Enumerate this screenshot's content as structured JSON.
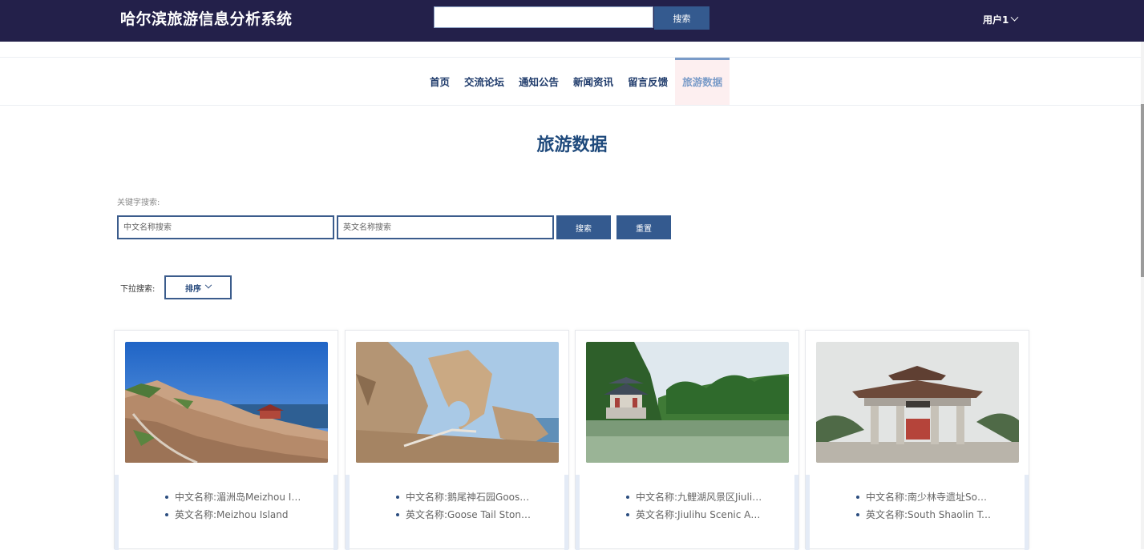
{
  "header": {
    "site_title": "哈尔滨旅游信息分析系统",
    "search_button": "搜索",
    "user_label": "用户1"
  },
  "nav": {
    "items": [
      {
        "label": "首页"
      },
      {
        "label": "交流论坛"
      },
      {
        "label": "通知公告"
      },
      {
        "label": "新闻资讯"
      },
      {
        "label": "留言反馈"
      },
      {
        "label": "旅游数据",
        "active": true
      }
    ]
  },
  "page": {
    "title": "旅游数据",
    "keyword_label": "关键字搜索:",
    "cn_placeholder": "中文名称搜索",
    "en_placeholder": "英文名称搜索",
    "search_button": "搜索",
    "reset_button": "重置",
    "dropdown_label": "下拉搜索:",
    "sort_button": "排序"
  },
  "cards": [
    {
      "cn": "中文名称:湄洲岛Meizhou Island",
      "en": "英文名称:Meizhou Island",
      "image": "island-coast-scene"
    },
    {
      "cn": "中文名称:鹅尾神石园Goose Tail Stone Park",
      "en": "英文名称:Goose Tail Stone Park",
      "image": "rock-arch-scene"
    },
    {
      "cn": "中文名称:九鲤湖风景区Jiulihu Scenic Area",
      "en": "英文名称:Jiulihu Scenic Area",
      "image": "lake-pavilion-scene"
    },
    {
      "cn": "中文名称:南少林寺遗址South Shaolin Temple Ruins",
      "en": "英文名称:South Shaolin Temple Ruins",
      "image": "temple-gate-scene"
    }
  ],
  "colors": {
    "header_bg": "#23204a",
    "accent": "#345a8f",
    "title": "#1f4a7c",
    "nav_active": "#7a9bc8"
  }
}
